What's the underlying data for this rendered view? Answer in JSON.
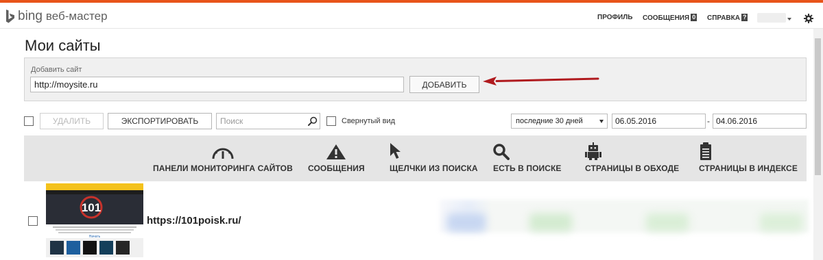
{
  "header": {
    "brand": "bing",
    "product": "веб-мастер",
    "nav": [
      {
        "label": "ПРОФИЛЬ"
      },
      {
        "label": "СООБЩЕНИЯ",
        "badge": "0"
      },
      {
        "label": "СПРАВКА",
        "badge": "?"
      }
    ],
    "icons": {
      "logo": "bing-logo-icon",
      "settings": "gear-icon",
      "user_menu": "chevron-down-icon"
    }
  },
  "page_title": "Мои сайты",
  "add_site": {
    "label": "Добавить сайт",
    "input_value": "http://moysite.ru",
    "button_label": "ДОБАВИТЬ",
    "annotation": "red-arrow-pointing-to-add-button"
  },
  "list_controls": {
    "delete_label": "УДАЛИТЬ",
    "export_label": "ЭКСПОРТИРОВАТЬ",
    "search_placeholder": "Поиск",
    "collapsed_view_label": "Свернутый вид",
    "period_select": "последние 30 дней",
    "date_from": "06.05.2016",
    "date_separator": "-",
    "date_to": "04.06.2016"
  },
  "toolbar": [
    {
      "label": "ПАНЕЛИ МОНИТОРИНГА САЙТОВ",
      "icon": "gauge-icon"
    },
    {
      "label": "СООБЩЕНИЯ",
      "icon": "warning-icon"
    },
    {
      "label": "ЩЕЛЧКИ ИЗ ПОИСКА",
      "icon": "cursor-icon"
    },
    {
      "label": "ЕСТЬ В ПОИСКЕ",
      "icon": "magnifier-icon"
    },
    {
      "label": "СТРАНИЦЫ В ОБХОДЕ",
      "icon": "robot-icon"
    },
    {
      "label": "СТРАНИЦЫ В ИНДЕКСЕ",
      "icon": "document-icon"
    }
  ],
  "sites": [
    {
      "url": "https://101poisk.ru/",
      "thumbnail_text": "101",
      "thumbnail_button": "Начать"
    }
  ],
  "colors": {
    "accent_strip": "#e8541a",
    "arrow": "#b01a1e",
    "toolbar_bg": "#e5e5e5",
    "panel_bg": "#f0f0f0"
  }
}
